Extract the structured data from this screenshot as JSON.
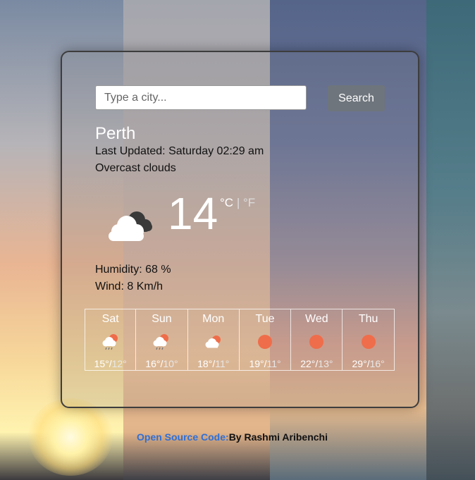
{
  "search": {
    "placeholder": "Type a city...",
    "button_label": "Search"
  },
  "weather": {
    "city": "Perth",
    "last_updated": "Last Updated: Saturday 02:29 am",
    "description": "Overcast clouds",
    "temperature": "14",
    "unit_c": "°C",
    "unit_sep": "|",
    "unit_f": "°F",
    "humidity": "Humidity: 68 %",
    "wind": "Wind: 8 Km/h",
    "icon": "cloud-icon"
  },
  "forecast": [
    {
      "day": "Sat",
      "max": "15°",
      "min": "12°",
      "icon": "cloud-rain-icon"
    },
    {
      "day": "Sun",
      "max": "16°",
      "min": "10°",
      "icon": "cloud-rain-icon"
    },
    {
      "day": "Mon",
      "max": "18°",
      "min": "11°",
      "icon": "sun-cloud-icon"
    },
    {
      "day": "Tue",
      "max": "19°",
      "min": "11°",
      "icon": "sun-icon"
    },
    {
      "day": "Wed",
      "max": "22°",
      "min": "13°",
      "icon": "sun-icon"
    },
    {
      "day": "Thu",
      "max": "29°",
      "min": "16°",
      "icon": "sun-icon"
    }
  ],
  "footer": {
    "link_text": "Open Source Code:",
    "author": "By Rashmi Aribenchi"
  },
  "colors": {
    "sun": "#ef6d4a",
    "button": "#6e757c",
    "link": "#2f6fd6"
  }
}
